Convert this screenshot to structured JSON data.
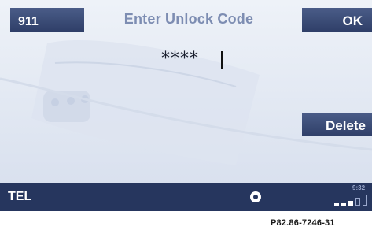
{
  "header": {
    "emergency_button": "911",
    "title": "Enter Unlock Code",
    "ok_button": "OK"
  },
  "code_entry": {
    "value": "****"
  },
  "actions": {
    "delete_button": "Delete"
  },
  "status_bar": {
    "label": "TEL",
    "time": "9:32",
    "center_icon": "disc-icon",
    "signal_icon": "signal-strength-icon"
  },
  "figure_id": "P82.86-7246-31",
  "colors": {
    "button_bg": "#3a4a74",
    "status_bar_bg": "#26365e",
    "title_text": "#7d8db2",
    "screen_bg": "#e3e9f3"
  }
}
